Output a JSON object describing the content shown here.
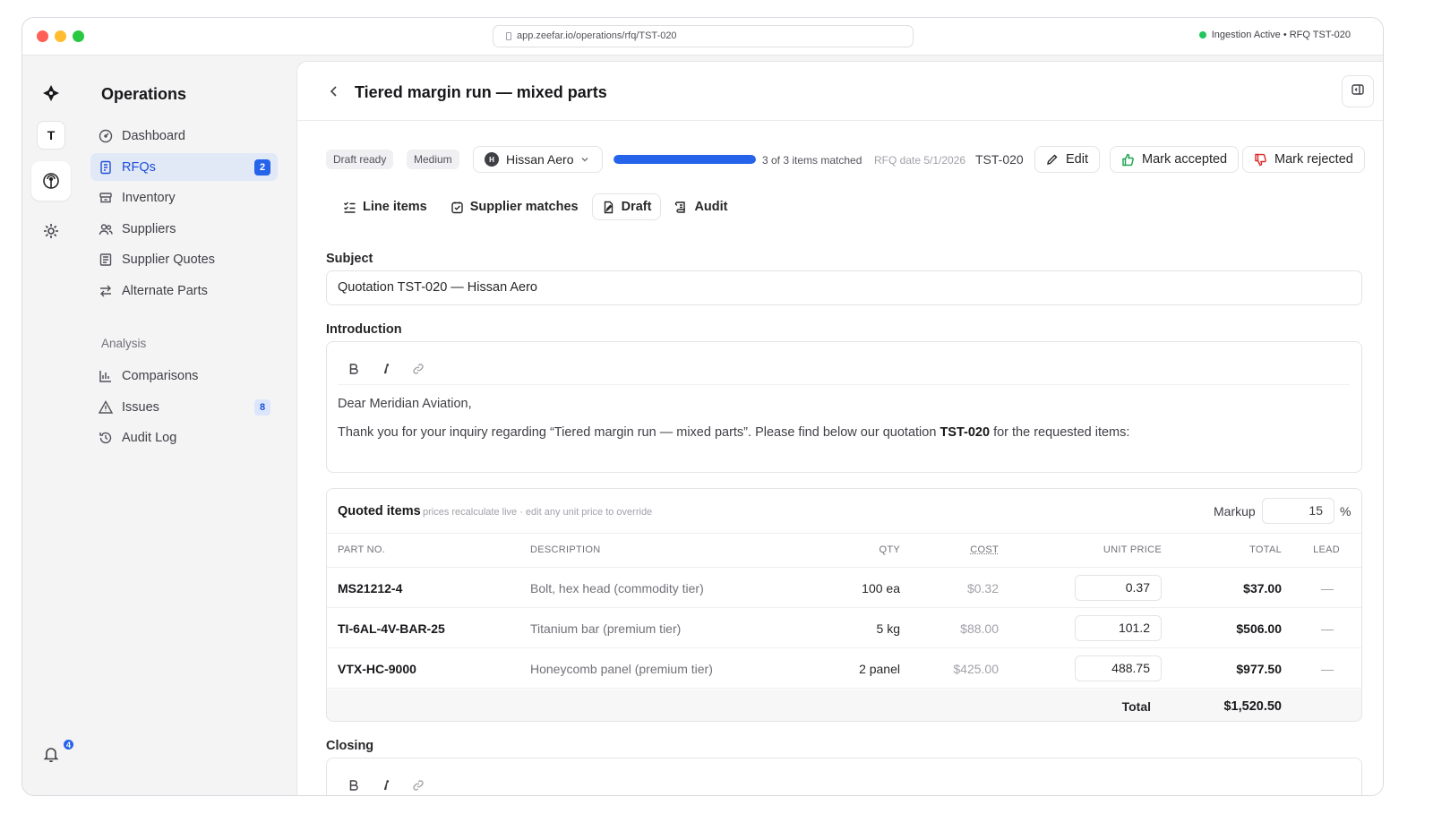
{
  "browser": {
    "url": "app.zeefar.io/operations/rfq/TST-020",
    "status": "Ingestion Active • RFQ TST-020"
  },
  "rail": {
    "workspace_initial": "T",
    "notification_count": "4"
  },
  "sidebar": {
    "title": "Operations",
    "items": [
      {
        "label": "Dashboard",
        "icon": "dashboard-icon"
      },
      {
        "label": "RFQs",
        "icon": "rfq-icon",
        "badge": "2"
      },
      {
        "label": "Inventory",
        "icon": "inventory-icon"
      },
      {
        "label": "Suppliers",
        "icon": "suppliers-icon"
      },
      {
        "label": "Supplier Quotes",
        "icon": "quotes-icon"
      },
      {
        "label": "Alternate Parts",
        "icon": "swap-icon"
      }
    ],
    "analysis_label": "Analysis",
    "analysis_items": [
      {
        "label": "Comparisons",
        "icon": "bar-chart-icon"
      },
      {
        "label": "Issues",
        "icon": "warning-icon",
        "badge": "8"
      },
      {
        "label": "Audit Log",
        "icon": "history-icon"
      }
    ]
  },
  "header": {
    "title": "Tiered margin run — mixed parts"
  },
  "status_bar": {
    "status_chip": "Draft ready",
    "priority_chip": "Medium",
    "supplier_initial": "H",
    "supplier": "Hissan Aero",
    "match_fraction": 1.0,
    "match_text": "3 of 3 items matched",
    "rfq_date": "RFQ date 5/1/2026",
    "rfq_id": "TST-020",
    "edit": "Edit",
    "accept": "Mark accepted",
    "reject": "Mark rejected"
  },
  "tabs": {
    "line_items": "Line items",
    "supplier_matches": "Supplier matches",
    "draft": "Draft",
    "audit": "Audit"
  },
  "draft": {
    "subject_label": "Subject",
    "subject_value": "Quotation TST-020 — Hissan Aero",
    "intro_label": "Introduction",
    "intro_greeting": "Dear Meridian Aviation,",
    "intro_body_before": "Thank you for your inquiry regarding “Tiered margin run — mixed parts”. Please find below our quotation ",
    "intro_body_bold": "TST-020",
    "intro_body_after": " for the requested items:",
    "closing_label": "Closing"
  },
  "quoted": {
    "title": "Quoted items",
    "hint": "prices recalculate live · edit any unit price to override",
    "markup_label": "Markup",
    "markup_value": "15",
    "markup_unit": "%",
    "columns": {
      "part": "PART NO.",
      "desc": "DESCRIPTION",
      "qty": "QTY",
      "cost": "COST",
      "unit_price": "UNIT PRICE",
      "total": "TOTAL",
      "lead": "LEAD"
    },
    "rows": [
      {
        "part": "MS21212-4",
        "desc": "Bolt, hex head (commodity tier)",
        "qty": "100 ea",
        "cost": "$0.32",
        "unit_price": "0.37",
        "total": "$37.00",
        "lead": "—"
      },
      {
        "part": "TI-6AL-4V-BAR-25",
        "desc": "Titanium bar (premium tier)",
        "qty": "5 kg",
        "cost": "$88.00",
        "unit_price": "101.2",
        "total": "$506.00",
        "lead": "—"
      },
      {
        "part": "VTX-HC-9000",
        "desc": "Honeycomb panel (premium tier)",
        "qty": "2 panel",
        "cost": "$425.00",
        "unit_price": "488.75",
        "total": "$977.50",
        "lead": "—"
      }
    ],
    "total_label": "Total",
    "total_value": "$1,520.50"
  }
}
